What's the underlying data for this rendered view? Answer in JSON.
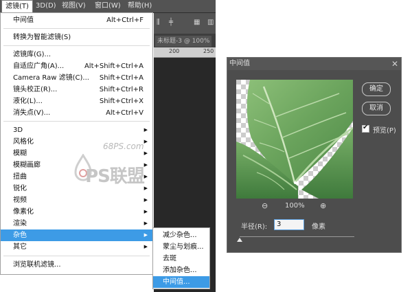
{
  "menubar": {
    "items": [
      "滤镜(T)",
      "3D(D)",
      "视图(V)",
      "窗口(W)",
      "帮助(H)"
    ],
    "active_index": 0
  },
  "document_tab": "未标题-3 @ 100%",
  "ruler_numbers": [
    "200",
    "250"
  ],
  "filter_menu": {
    "items": [
      {
        "label": "中间值",
        "shortcut": "Alt+Ctrl+F"
      },
      {
        "label": "转换为智能滤镜(S)",
        "shortcut": ""
      },
      {
        "label": "滤镜库(G)...",
        "shortcut": ""
      },
      {
        "label": "自适应广角(A)...",
        "shortcut": "Alt+Shift+Ctrl+A"
      },
      {
        "label": "Camera Raw 滤镜(C)...",
        "shortcut": "Shift+Ctrl+A"
      },
      {
        "label": "镜头校正(R)...",
        "shortcut": "Shift+Ctrl+R"
      },
      {
        "label": "液化(L)...",
        "shortcut": "Shift+Ctrl+X"
      },
      {
        "label": "消失点(V)...",
        "shortcut": "Alt+Ctrl+V"
      },
      {
        "label": "3D",
        "submenu": true
      },
      {
        "label": "风格化",
        "submenu": true
      },
      {
        "label": "模糊",
        "submenu": true
      },
      {
        "label": "模糊画廊",
        "submenu": true
      },
      {
        "label": "扭曲",
        "submenu": true
      },
      {
        "label": "锐化",
        "submenu": true
      },
      {
        "label": "视频",
        "submenu": true
      },
      {
        "label": "像素化",
        "submenu": true
      },
      {
        "label": "渲染",
        "submenu": true
      },
      {
        "label": "杂色",
        "submenu": true,
        "selected": true
      },
      {
        "label": "其它",
        "submenu": true
      },
      {
        "label": "浏览联机滤镜...",
        "shortcut": ""
      }
    ]
  },
  "noise_submenu": {
    "items": [
      "减少杂色...",
      "蒙尘与划痕...",
      "去斑",
      "添加杂色...",
      "中间值..."
    ],
    "selected_index": 4
  },
  "watermark": {
    "site": "68PS.com",
    "brand": "PS联盟"
  },
  "median_dialog": {
    "title": "中间值",
    "close_glyph": "✕",
    "ok_label": "确定",
    "cancel_label": "取消",
    "preview_label": "预览(P)",
    "preview_checked": true,
    "zoom_out_glyph": "⊖",
    "zoom_in_glyph": "⊕",
    "zoom_level": "100%",
    "radius_label": "半径(R):",
    "radius_value": "3",
    "radius_unit": "像素",
    "slider_fraction": 0.0
  },
  "colors": {
    "menu_highlight": "#3d9be6",
    "dialog_bg": "#4d4d4d",
    "ps_chrome": "#535353"
  }
}
